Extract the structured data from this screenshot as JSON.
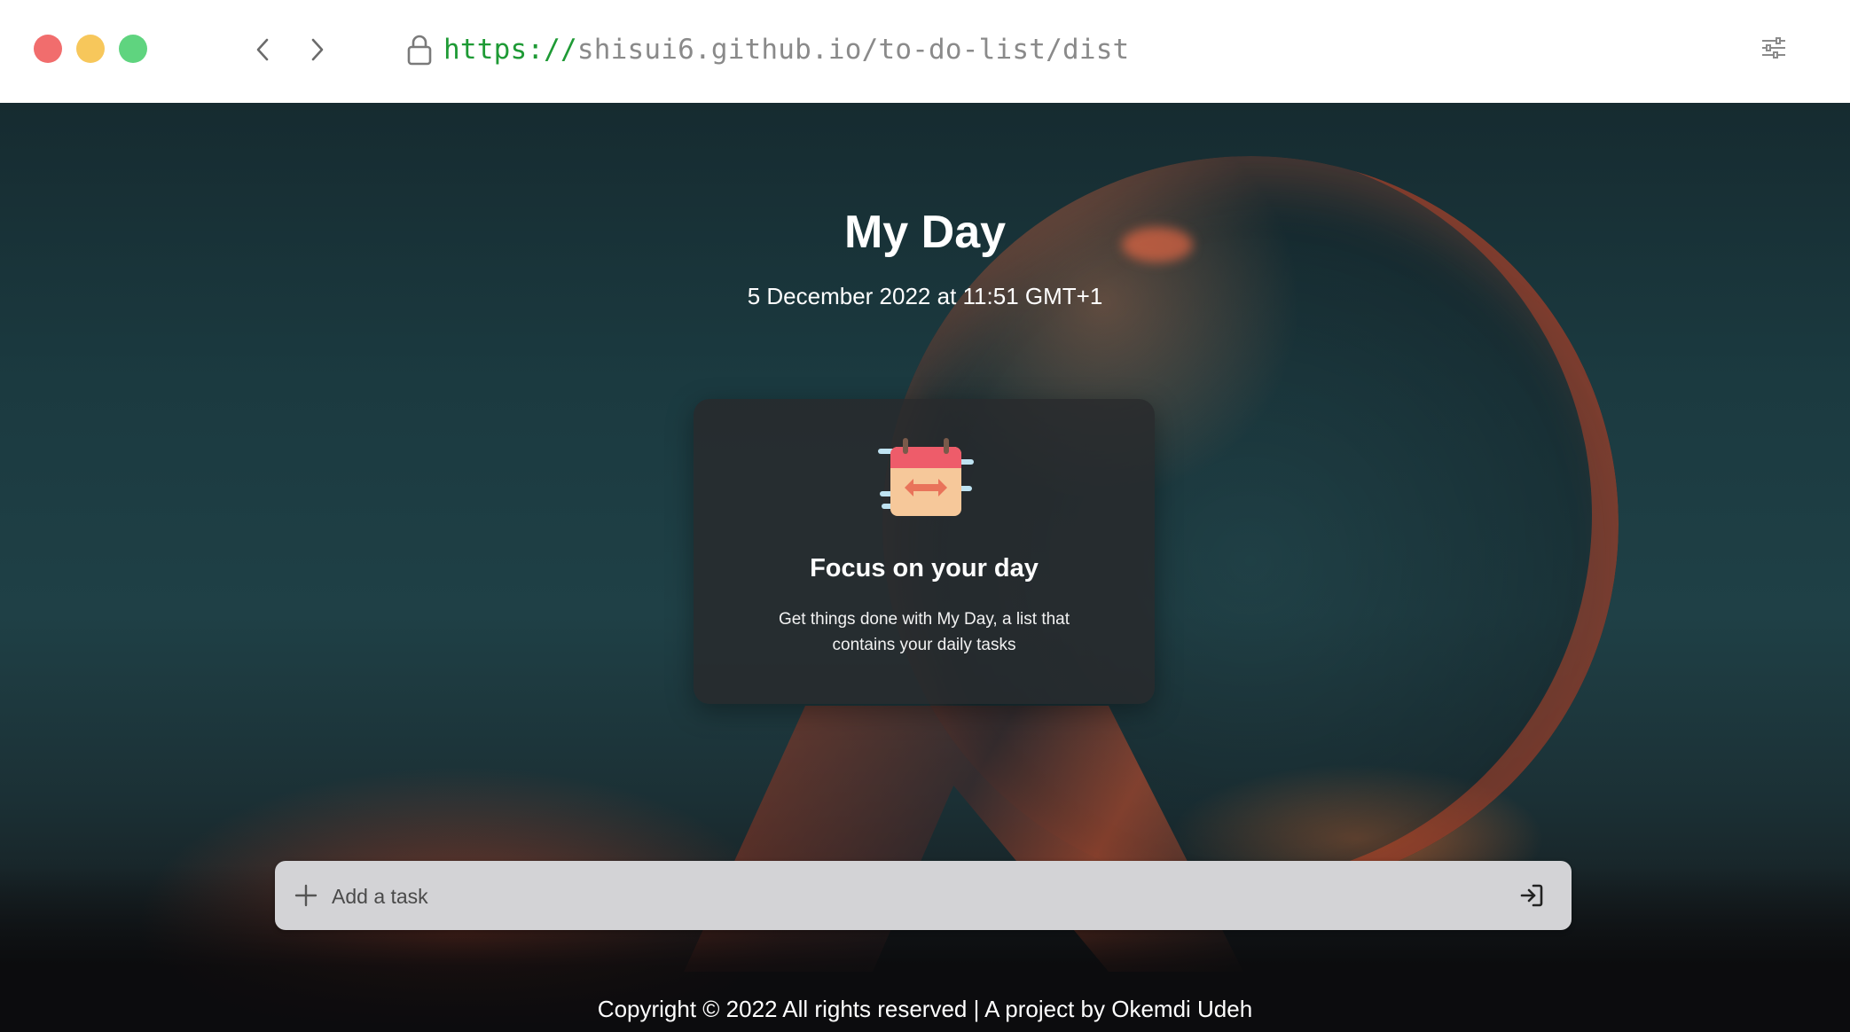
{
  "browser": {
    "url_scheme": "https://",
    "url_rest": "shisui6.github.io/to-do-list/dist",
    "window_controls": [
      "close",
      "minimize",
      "maximize"
    ],
    "icons": {
      "back": "chevron-left-icon",
      "forward": "chevron-right-icon",
      "lock": "lock-icon",
      "menu": "sliders-icon"
    }
  },
  "page": {
    "title": "My Day",
    "date": "5 December 2022 at 11:51 GMT+1"
  },
  "card": {
    "icon": "calendar-icon",
    "title": "Focus on your day",
    "text": "Get things done with My Day, a list that contains your daily tasks"
  },
  "task_input": {
    "placeholder": "Add a task",
    "value": "",
    "add_icon": "plus-icon",
    "submit_icon": "sign-in-icon"
  },
  "footer": {
    "text": "Copyright © 2022 All rights reserved | A project by Okemdi Udeh"
  },
  "colors": {
    "url_scheme": "#1e9a35",
    "url_rest": "#8a8a8a",
    "traffic_red": "#f16d6d",
    "traffic_yellow": "#f7c75b",
    "traffic_green": "#5fd47f",
    "task_bar_bg": "#d3d3d6"
  }
}
